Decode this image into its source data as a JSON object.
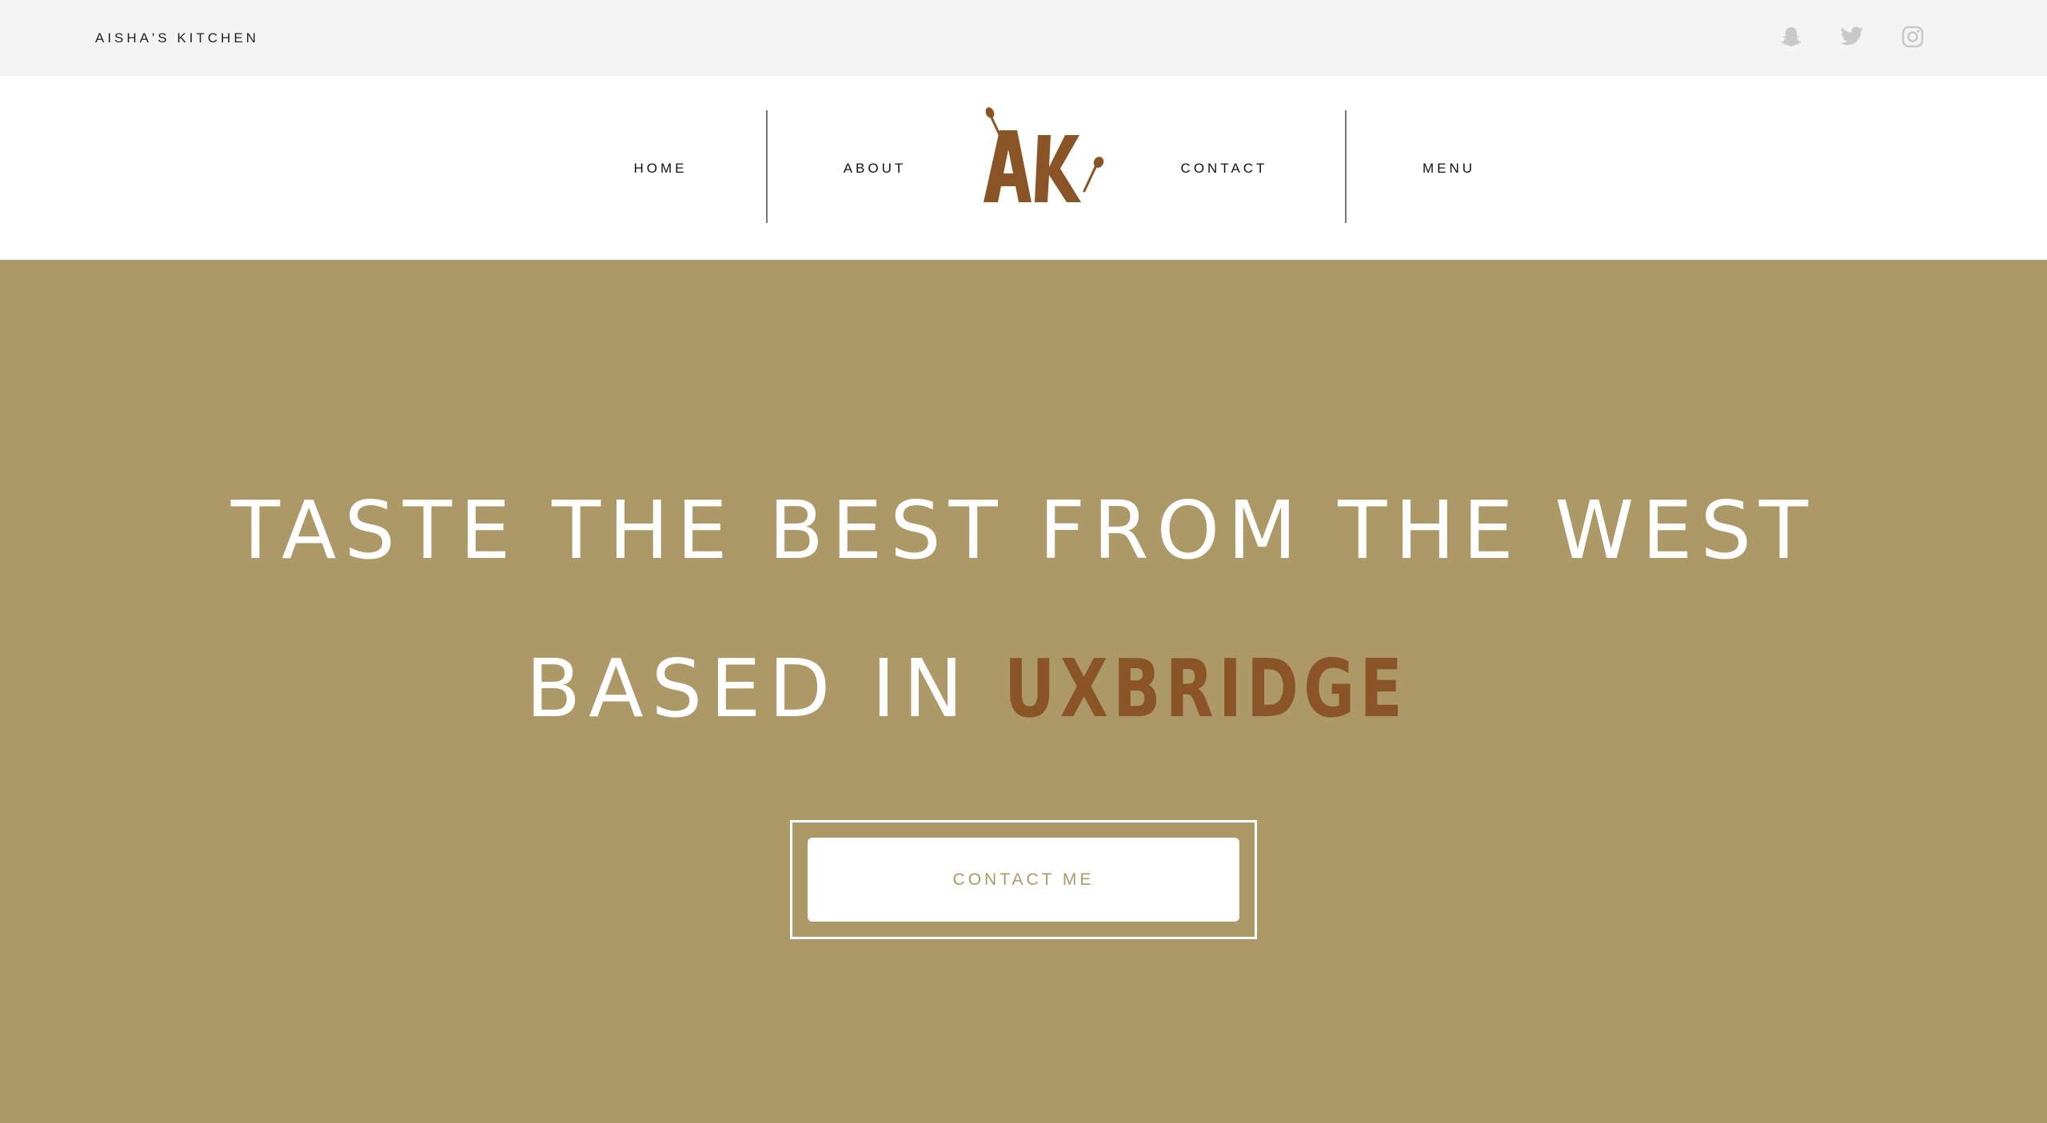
{
  "topbar": {
    "brand": "AISHA'S KITCHEN",
    "social": [
      "snapchat-icon",
      "twitter-icon",
      "instagram-icon"
    ]
  },
  "nav": {
    "home": "HOME",
    "about": "ABOUT",
    "contact": "CONTACT",
    "menu": "MENU",
    "logo_text": "AK"
  },
  "hero": {
    "line1": "TASTE THE BEST FROM THE WEST",
    "line2_prefix": "BASED IN ",
    "line2_highlight": "UXBRIDGE",
    "cta": "CONTACT ME"
  },
  "colors": {
    "hero_bg": "#ad9967",
    "accent_brown": "#8b5426",
    "topbar_bg": "#f4f4f4",
    "icon_gray": "#c8c8c8"
  }
}
